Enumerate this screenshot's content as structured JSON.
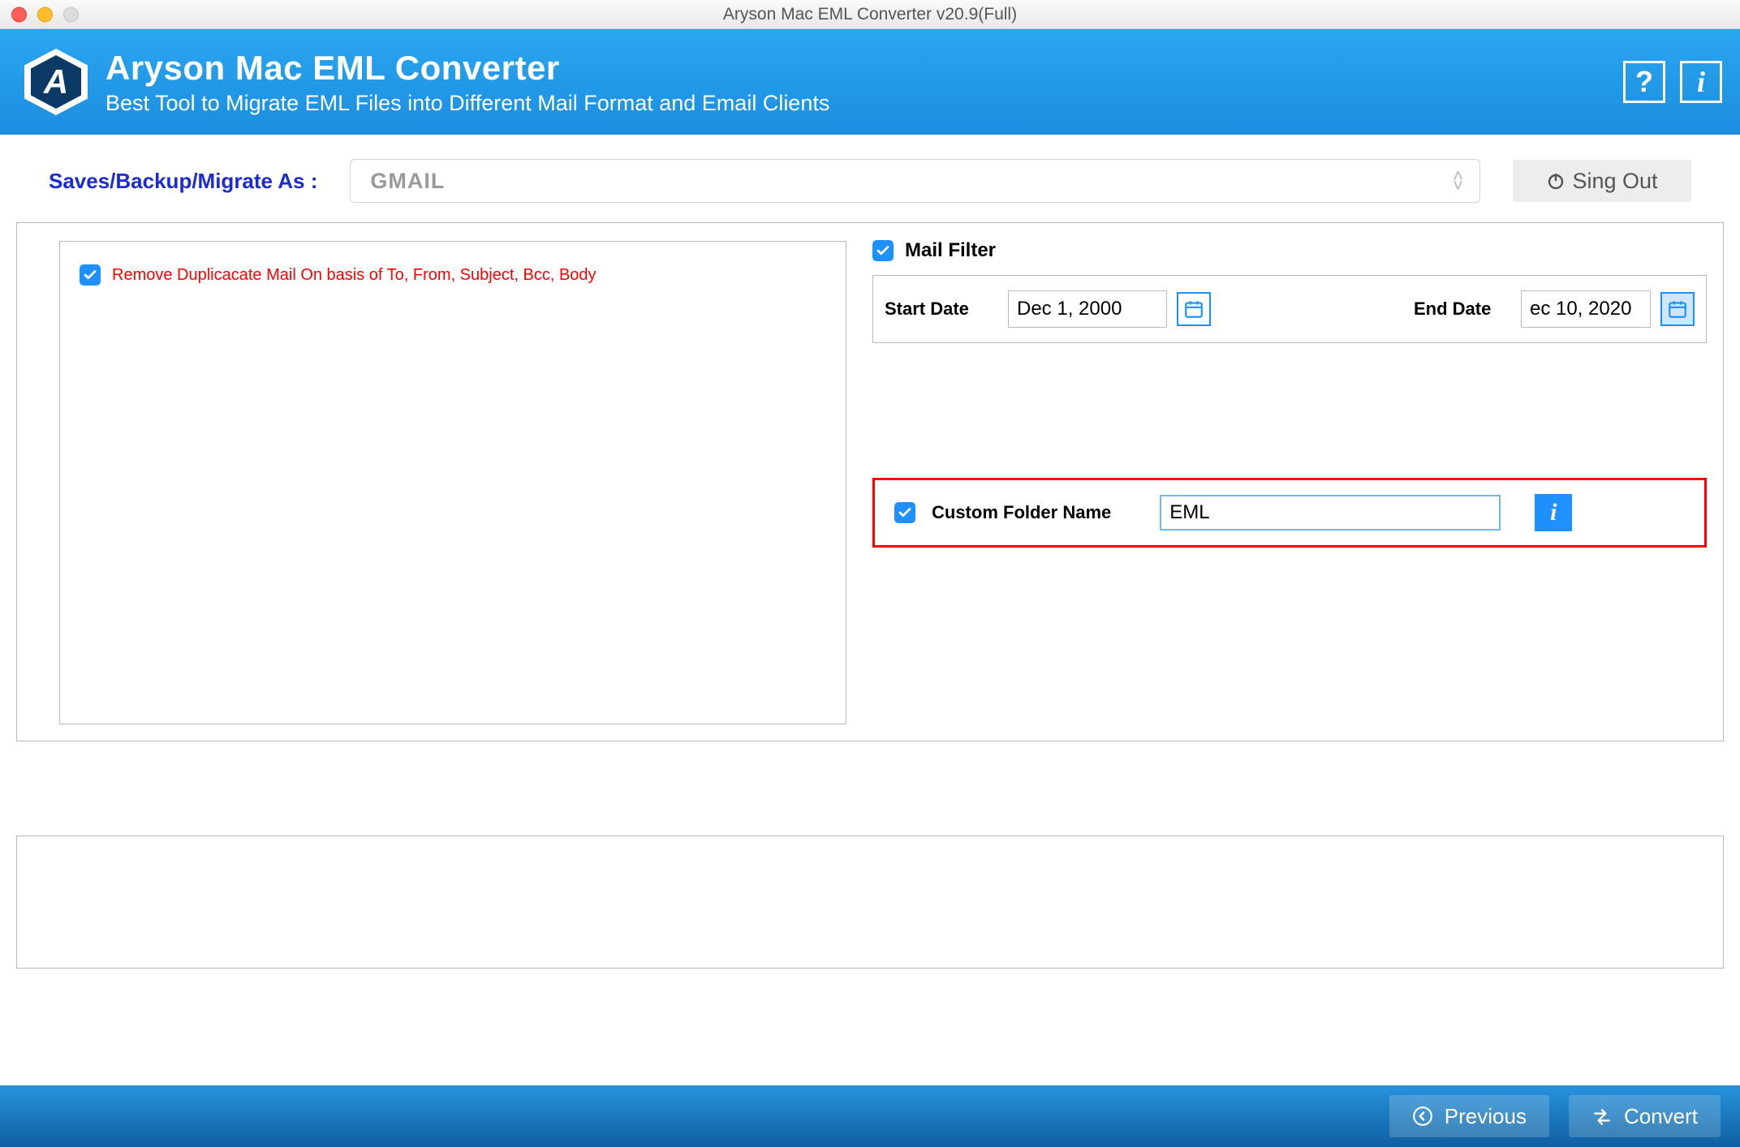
{
  "window": {
    "title": "Aryson Mac EML Converter v20.9(Full)"
  },
  "header": {
    "title": "Aryson Mac EML Converter",
    "subtitle": "Best Tool to Migrate EML Files into Different Mail Format and Email Clients",
    "logo_letter": "A"
  },
  "topstrip": {
    "save_label": "Saves/Backup/Migrate As :",
    "selected_format": "GMAIL",
    "signout_label": "Sing Out"
  },
  "options": {
    "remove_duplicates_label": "Remove Duplicacate Mail On basis of To, From, Subject, Bcc, Body",
    "remove_duplicates_checked": true
  },
  "mail_filter": {
    "title": "Mail Filter",
    "checked": true,
    "start_label": "Start Date",
    "start_value": "Dec 1, 2000",
    "end_label": "End Date",
    "end_value": "ec 10, 2020"
  },
  "custom_folder": {
    "checked": true,
    "label": "Custom Folder Name",
    "value": "EML"
  },
  "footer": {
    "previous_label": "Previous",
    "convert_label": "Convert"
  }
}
